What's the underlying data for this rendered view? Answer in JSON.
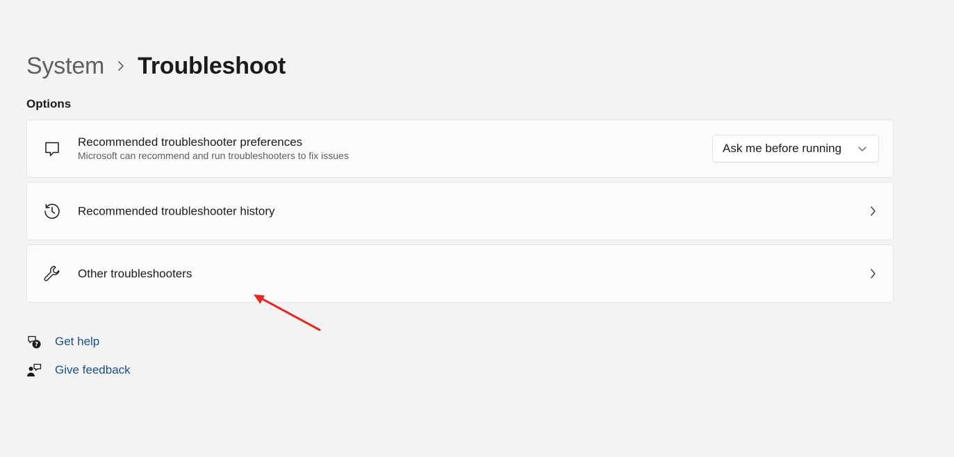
{
  "breadcrumb": {
    "parent": "System",
    "current": "Troubleshoot"
  },
  "section": {
    "title": "Options"
  },
  "cards": [
    {
      "title": "Recommended troubleshooter preferences",
      "subtitle": "Microsoft can recommend and run troubleshooters to fix issues",
      "icon": "chat-bubble-icon",
      "dropdown_value": "Ask me before running"
    },
    {
      "title": "Recommended troubleshooter history",
      "icon": "history-icon"
    },
    {
      "title": "Other troubleshooters",
      "icon": "wrench-icon"
    }
  ],
  "help": {
    "get_help": "Get help",
    "give_feedback": "Give feedback"
  },
  "colors": {
    "background": "#f3f3f3",
    "card": "#fbfbfb",
    "link": "#1a4e8a",
    "annotation": "#e8251f"
  }
}
